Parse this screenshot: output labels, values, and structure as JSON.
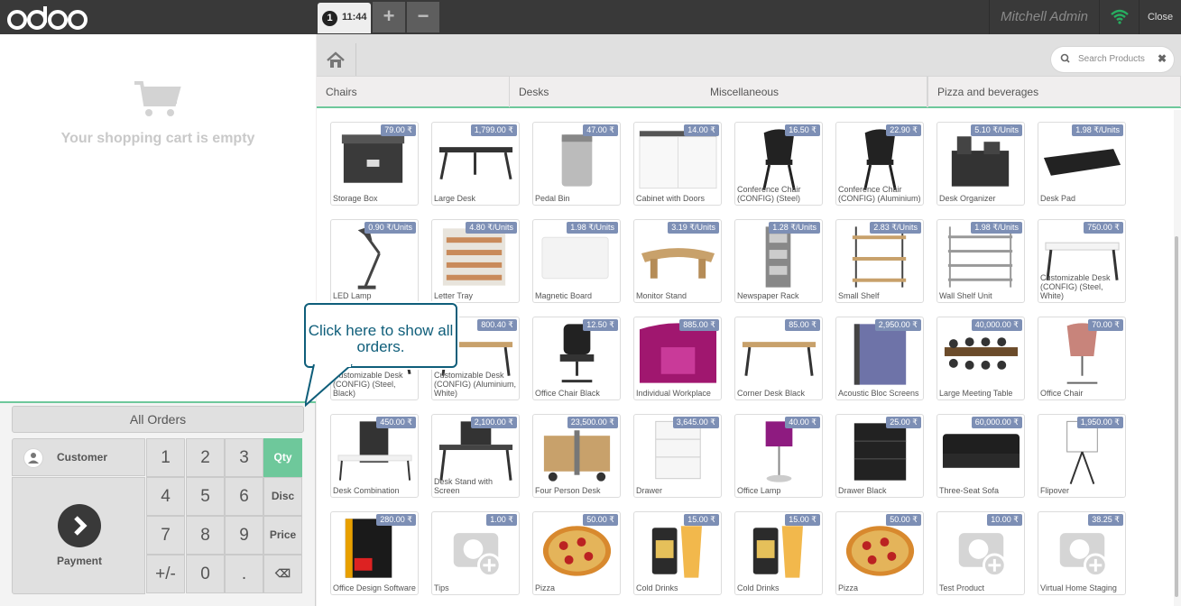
{
  "topbar": {
    "brand": "odoo",
    "order_number": "1",
    "order_time": "11:44",
    "add_order": "+",
    "remove_order": "−",
    "user": "Mitchell Admin",
    "close": "Close",
    "wifi_icon": "wifi-icon"
  },
  "cart": {
    "empty_message": "Your shopping cart is empty"
  },
  "callout": {
    "text": "Click here to show all orders."
  },
  "controls": {
    "all_orders": "All Orders",
    "customer": "Customer",
    "payment": "Payment",
    "keys": [
      [
        "1",
        "2",
        "3",
        "Qty"
      ],
      [
        "4",
        "5",
        "6",
        "Disc"
      ],
      [
        "7",
        "8",
        "9",
        "Price"
      ],
      [
        "+/-",
        "0",
        ".",
        "⌫"
      ]
    ]
  },
  "search": {
    "placeholder": "Search Products",
    "clear": "✖"
  },
  "categories": [
    {
      "label": "Chairs"
    },
    {
      "label": "Desks"
    },
    {
      "label": "Miscellaneous"
    },
    {
      "label": "Pizza and beverages"
    }
  ],
  "products": [
    {
      "name": "Storage Box",
      "price": "79.00 ₹",
      "icon": "box"
    },
    {
      "name": "Large Desk",
      "price": "1,799.00 ₹",
      "icon": "desk"
    },
    {
      "name": "Pedal Bin",
      "price": "47.00 ₹",
      "icon": "bin"
    },
    {
      "name": "Cabinet with Doors",
      "price": "14.00 ₹",
      "icon": "cabinet"
    },
    {
      "name": "Conference Chair (CONFIG) (Steel)",
      "price": "16.50 ₹",
      "icon": "chair-black"
    },
    {
      "name": "Conference Chair (CONFIG) (Aluminium)",
      "price": "22.90 ₹",
      "icon": "chair-black"
    },
    {
      "name": "Desk Organizer",
      "price": "5.10 ₹/Units",
      "icon": "organizer"
    },
    {
      "name": "Desk Pad",
      "price": "1.98 ₹/Units",
      "icon": "pad"
    },
    {
      "name": "LED Lamp",
      "price": "0.90 ₹/Units",
      "icon": "lamp"
    },
    {
      "name": "Letter Tray",
      "price": "4.80 ₹/Units",
      "icon": "tray"
    },
    {
      "name": "Magnetic Board",
      "price": "1.98 ₹/Units",
      "icon": "board"
    },
    {
      "name": "Monitor Stand",
      "price": "3.19 ₹/Units",
      "icon": "stand"
    },
    {
      "name": "Newspaper Rack",
      "price": "1.28 ₹/Units",
      "icon": "rack"
    },
    {
      "name": "Small Shelf",
      "price": "2.83 ₹/Units",
      "icon": "shelf"
    },
    {
      "name": "Wall Shelf Unit",
      "price": "1.98 ₹/Units",
      "icon": "wallshelf"
    },
    {
      "name": "Customizable Desk (CONFIG) (Steel, White)",
      "price": "750.00 ₹",
      "icon": "desk-white"
    },
    {
      "name": "Customizable Desk (CONFIG) (Steel, Black)",
      "price": "",
      "icon": "desk"
    },
    {
      "name": "Customizable Desk (CONFIG) (Aluminium, White)",
      "price": "800.40 ₹",
      "icon": "desk-wood"
    },
    {
      "name": "Office Chair Black",
      "price": "12.50 ₹",
      "icon": "office-chair"
    },
    {
      "name": "Individual Workplace",
      "price": "885.00 ₹",
      "icon": "pod"
    },
    {
      "name": "Corner Desk Black",
      "price": "85.00 ₹",
      "icon": "desk-wood"
    },
    {
      "name": "Acoustic Bloc Screens",
      "price": "2,950.00 ₹",
      "icon": "screens"
    },
    {
      "name": "Large Meeting Table",
      "price": "40,000.00 ₹",
      "icon": "meeting"
    },
    {
      "name": "Office Chair",
      "price": "70.00 ₹",
      "icon": "chair-pink"
    },
    {
      "name": "Desk Combination",
      "price": "450.00 ₹",
      "icon": "combo"
    },
    {
      "name": "Desk Stand with Screen",
      "price": "2,100.00 ₹",
      "icon": "desk-screen"
    },
    {
      "name": "Four Person Desk",
      "price": "23,500.00 ₹",
      "icon": "fourdesk"
    },
    {
      "name": "Drawer",
      "price": "3,645.00 ₹",
      "icon": "drawer"
    },
    {
      "name": "Office Lamp",
      "price": "40.00 ₹",
      "icon": "purple-lamp"
    },
    {
      "name": "Drawer Black",
      "price": "25.00 ₹",
      "icon": "drawer-black"
    },
    {
      "name": "Three-Seat Sofa",
      "price": "60,000.00 ₹",
      "icon": "sofa"
    },
    {
      "name": "Flipover",
      "price": "1,950.00 ₹",
      "icon": "flipover"
    },
    {
      "name": "Office Design Software",
      "price": "280.00 ₹",
      "icon": "software"
    },
    {
      "name": "Tips",
      "price": "1.00 ₹",
      "icon": "placeholder"
    },
    {
      "name": "Pizza",
      "price": "50.00 ₹",
      "icon": "pizza"
    },
    {
      "name": "Cold Drinks",
      "price": "15.00 ₹",
      "icon": "drink"
    },
    {
      "name": "Cold Drinks",
      "price": "15.00 ₹",
      "icon": "drink"
    },
    {
      "name": "Pizza",
      "price": "50.00 ₹",
      "icon": "pizza"
    },
    {
      "name": "Test Product",
      "price": "10.00 ₹",
      "icon": "placeholder"
    },
    {
      "name": "Virtual Home Staging",
      "price": "38.25 ₹",
      "icon": "placeholder"
    }
  ],
  "colors": {
    "accent": "#6ec89b",
    "topbar": "#393939",
    "price_badge": "#7d8fb5",
    "callout": "#0f5e7a"
  }
}
